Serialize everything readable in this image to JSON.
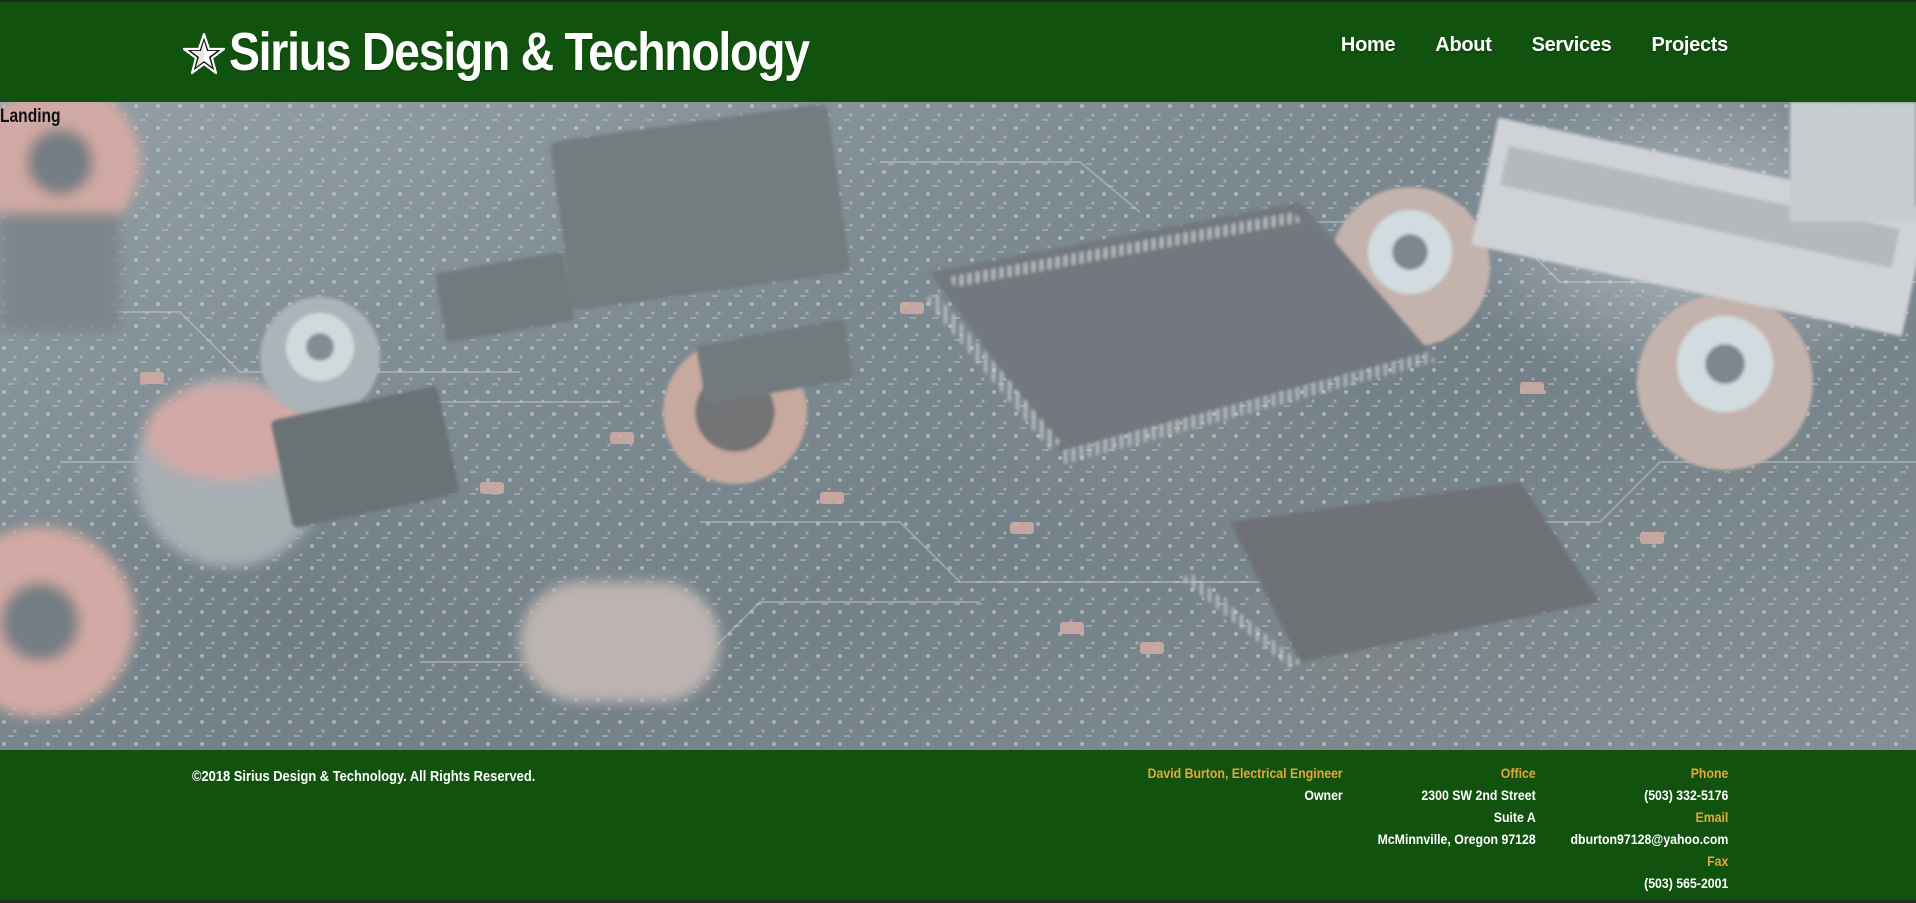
{
  "header": {
    "title": "Sirius Design & Technology",
    "logo_icon": "star-icon",
    "nav": [
      {
        "label": "Home"
      },
      {
        "label": "About"
      },
      {
        "label": "Services"
      },
      {
        "label": "Projects"
      }
    ]
  },
  "hero": {
    "label": "Landing",
    "image": "circuit-board-photo"
  },
  "footer": {
    "copyright": "©2018 Sirius Design & Technology. All Rights Reserved.",
    "owner": {
      "name": "David Burton, Electrical Engineer",
      "role": "Owner"
    },
    "office": {
      "label": "Office",
      "line1": "2300 SW 2nd Street",
      "line2": "Suite A",
      "line3": "McMinnville, Oregon 97128"
    },
    "contact": {
      "phone_label": "Phone",
      "phone": "(503) 332-5176",
      "email_label": "Email",
      "email": "dburton97128@yahoo.com",
      "fax_label": "Fax",
      "fax": "(503) 565-2001"
    }
  },
  "colors": {
    "brand_green": "#12520f",
    "accent_gold": "#e3a83a",
    "text_white": "#ffffff"
  }
}
